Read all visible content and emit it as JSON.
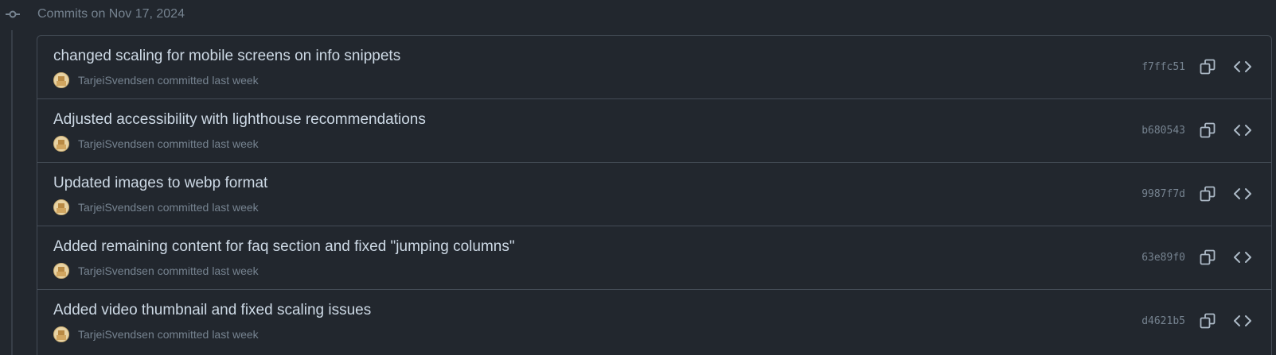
{
  "header": {
    "title": "Commits on Nov 17, 2024",
    "icon": "git-commit-icon"
  },
  "colors": {
    "background": "#22272e",
    "border": "#444c56",
    "title_text": "#cdd9e5",
    "muted_text": "#768390"
  },
  "commits": [
    {
      "message": "changed scaling for mobile screens on info snippets",
      "author": "TarjeiSvendsen",
      "verb": "committed",
      "time": "last week",
      "sha": "f7ffc51"
    },
    {
      "message": "Adjusted accessibility with lighthouse recommendations",
      "author": "TarjeiSvendsen",
      "verb": "committed",
      "time": "last week",
      "sha": "b680543"
    },
    {
      "message": "Updated images to webp format",
      "author": "TarjeiSvendsen",
      "verb": "committed",
      "time": "last week",
      "sha": "9987f7d"
    },
    {
      "message": "Added remaining content for faq section and fixed \"jumping columns\"",
      "author": "TarjeiSvendsen",
      "verb": "committed",
      "time": "last week",
      "sha": "63e89f0"
    },
    {
      "message": "Added video thumbnail and fixed scaling issues",
      "author": "TarjeiSvendsen",
      "verb": "committed",
      "time": "last week",
      "sha": "d4621b5"
    }
  ]
}
